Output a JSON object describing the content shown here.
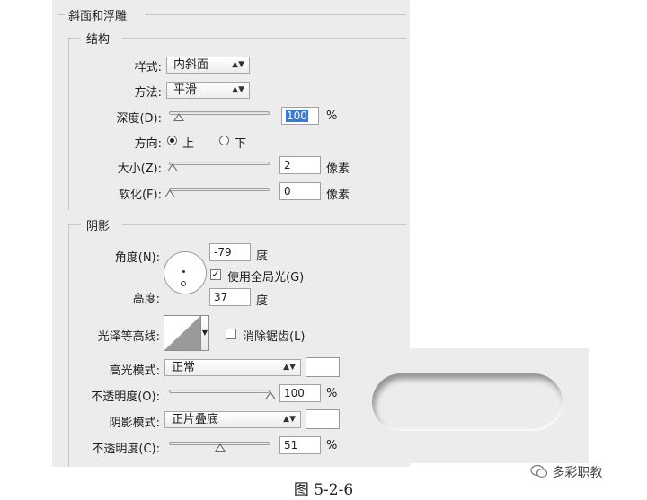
{
  "bevel_emboss": {
    "section_title": "斜面和浮雕",
    "structure": {
      "group_title": "结构",
      "style_label": "样式:",
      "style_value": "内斜面",
      "technique_label": "方法:",
      "technique_value": "平滑",
      "depth_label": "深度(D):",
      "depth_value": "100",
      "depth_unit": "%",
      "direction_label": "方向:",
      "direction_up": "上",
      "direction_down": "下",
      "direction_selected": "上",
      "size_label": "大小(Z):",
      "size_value": "2",
      "size_unit": "像素",
      "soften_label": "软化(F):",
      "soften_value": "0",
      "soften_unit": "像素"
    },
    "shading": {
      "group_title": "阴影",
      "angle_label": "角度(N):",
      "angle_value": "-79",
      "angle_unit": "度",
      "global_light_label": "使用全局光(G)",
      "global_light_checked": true,
      "altitude_label": "高度:",
      "altitude_value": "37",
      "altitude_unit": "度",
      "gloss_contour_label": "光泽等高线:",
      "anti_aliased_label": "消除锯齿(L)",
      "anti_aliased_checked": false,
      "highlight_mode_label": "高光模式:",
      "highlight_mode_value": "正常",
      "highlight_color": "#ffffff",
      "highlight_opacity_label": "不透明度(O):",
      "highlight_opacity_value": "100",
      "highlight_opacity_unit": "%",
      "shadow_mode_label": "阴影模式:",
      "shadow_mode_value": "正片叠底",
      "shadow_color": "#ffffff",
      "shadow_opacity_label": "不透明度(C):",
      "shadow_opacity_value": "51",
      "shadow_opacity_unit": "%"
    }
  },
  "caption": "图 5-2-6",
  "watermark": "多彩职教"
}
